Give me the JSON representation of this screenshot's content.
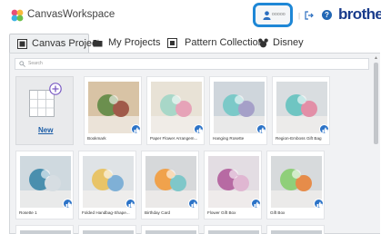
{
  "app": {
    "title": "CanvasWorkspace",
    "user_name": "ooooo",
    "brand": "brother",
    "help_glyph": "?"
  },
  "tabs": [
    {
      "label": "Canvas Project",
      "icon": "canvas-icon",
      "active": true
    },
    {
      "label": "My Projects",
      "icon": "folder-icon",
      "active": false
    },
    {
      "label": "Pattern Collection",
      "icon": "pattern-icon",
      "active": false
    },
    {
      "label": "Disney",
      "icon": "mickey-icon",
      "active": false
    }
  ],
  "search": {
    "placeholder": "Search"
  },
  "new_item": {
    "label": "New"
  },
  "projects": [
    {
      "label": "Bookmark",
      "thumb": [
        "#d8c3a5",
        "#6b8f4e",
        "#a05a4a"
      ]
    },
    {
      "label": "Paper Flower Arrangem...",
      "thumb": [
        "#e8e2d6",
        "#a8d7c8",
        "#e6a3b8"
      ]
    },
    {
      "label": "Hanging Rosette",
      "thumb": [
        "#cfd6dc",
        "#7bc9c8",
        "#a5a0c8"
      ]
    },
    {
      "label": "Region-Emboss Gift Bag",
      "thumb": [
        "#d9dde0",
        "#6fc5c2",
        "#e28fa7"
      ]
    },
    {
      "label": "Rosette 1",
      "thumb": [
        "#cfd9df",
        "#4a8fae",
        "#d6dde2"
      ]
    },
    {
      "label": "Folded Handbag-Shape...",
      "thumb": [
        "#dfe3e6",
        "#e8c468",
        "#7fb0d6"
      ]
    },
    {
      "label": "Birthday Card",
      "thumb": [
        "#d6d8da",
        "#f0a24c",
        "#7fc7c9"
      ]
    },
    {
      "label": "Flower Gift Box",
      "thumb": [
        "#e3dde3",
        "#b76aa3",
        "#e0b7d2"
      ]
    },
    {
      "label": "Gift Box",
      "thumb": [
        "#d7dadc",
        "#8fcf7a",
        "#e68c4a"
      ]
    }
  ]
}
